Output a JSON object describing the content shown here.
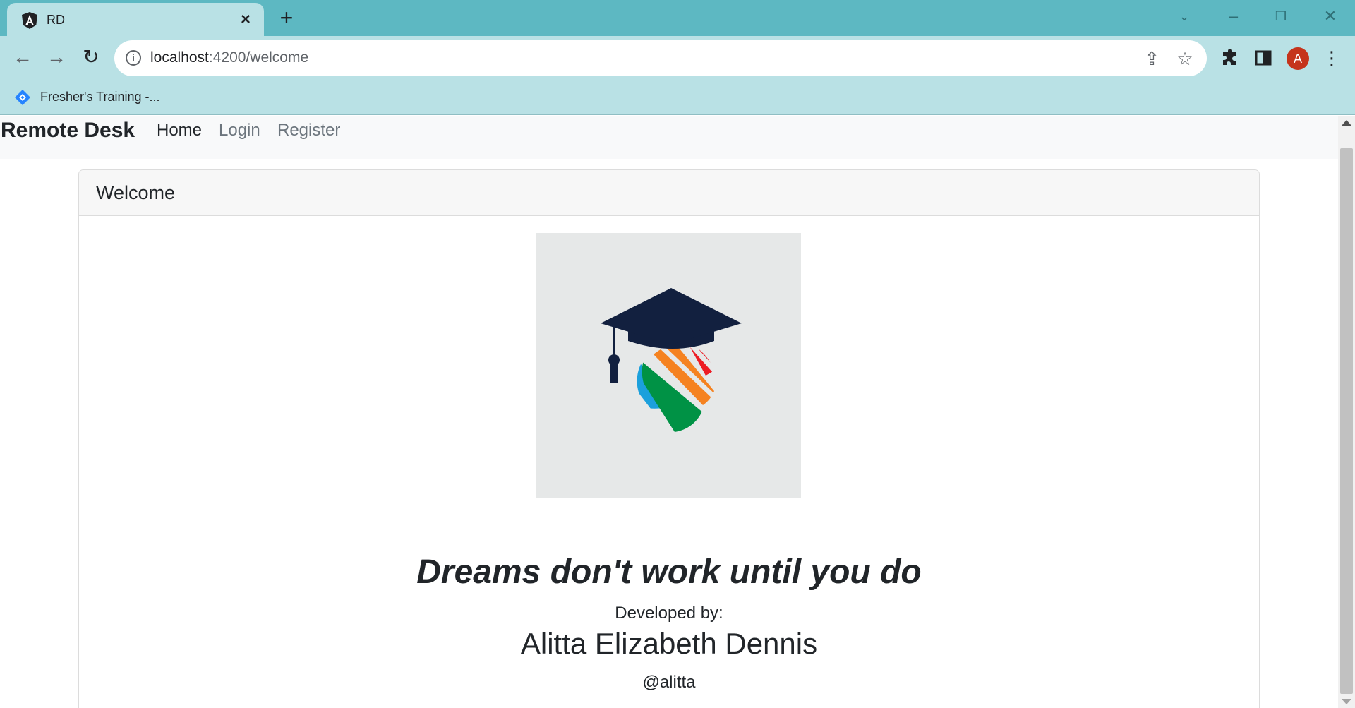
{
  "browser": {
    "tab_title": "RD",
    "tab_favicon": "angular-icon",
    "url_host": "localhost",
    "url_path": ":4200/welcome",
    "avatar_initial": "A",
    "bookmark_label": "Fresher's Training -...",
    "bookmark_icon": "jira-diamond-icon",
    "accent_color": "#5db8c2",
    "toolbar_color": "#b9e1e5"
  },
  "navbar": {
    "brand": "Remote Desk",
    "links": [
      "Home",
      "Login",
      "Register"
    ]
  },
  "card": {
    "header": "Welcome"
  },
  "content": {
    "logo": "graduation-cap-globe-logo",
    "quote": "Dreams don't work until you do",
    "developed_by_label": "Developed by:",
    "developer_name": "Alitta Elizabeth Dennis",
    "handle": "@alitta"
  }
}
